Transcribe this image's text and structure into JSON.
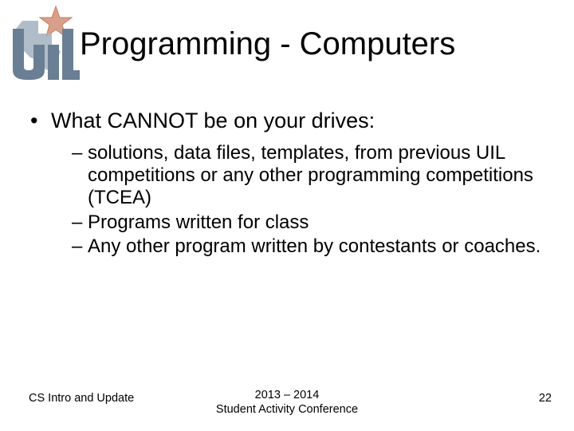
{
  "title": "Programming - Computers",
  "bullets": {
    "l1": "What CANNOT be on your drives:",
    "l2a": "solutions, data files, templates, from previous UIL competitions or any other programming competitions (TCEA)",
    "l2b": "Programs written for class",
    "l2c": "Any other program written by contestants or coaches."
  },
  "footer": {
    "left": "CS Intro and Update",
    "center_line1": "2013 – 2014",
    "center_line2": "Student Activity Conference",
    "page": "22"
  },
  "logo": {
    "name": "uil-texas-logo"
  }
}
